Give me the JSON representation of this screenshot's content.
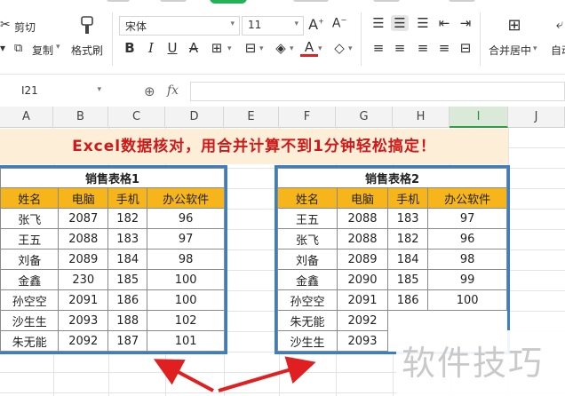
{
  "ribbon": {
    "cut_label": "剪切",
    "copy_label": "复制",
    "format_painter_label": "格式刷",
    "font_name": "宋体",
    "font_size": "11",
    "merge_center_label": "合并居中",
    "wrap_label": "自动",
    "accent_color": "#22b357"
  },
  "formula_bar": {
    "cell_ref": "I21",
    "fx_label": "fx",
    "content": ""
  },
  "columns": [
    "A",
    "B",
    "C",
    "D",
    "E",
    "F",
    "G",
    "H",
    "I",
    "J"
  ],
  "selected_column": "I",
  "banner": {
    "text": "Excel数据核对，用合并计算不到1分钟轻松搞定！",
    "color": "#d01818",
    "background": "#fdeed8"
  },
  "table1": {
    "title": "销售表格1",
    "headers": [
      "姓名",
      "电脑",
      "手机",
      "办公软件"
    ],
    "rows": [
      [
        "张飞",
        "2087",
        "182",
        "96"
      ],
      [
        "王五",
        "2088",
        "183",
        "97"
      ],
      [
        "刘备",
        "2089",
        "184",
        "98"
      ],
      [
        "金鑫",
        "230",
        "185",
        "100"
      ],
      [
        "孙空空",
        "2091",
        "186",
        "100"
      ],
      [
        "沙生生",
        "2093",
        "188",
        "102"
      ],
      [
        "朱无能",
        "2092",
        "187",
        "101"
      ]
    ]
  },
  "table2": {
    "title": "销售表格2",
    "headers": [
      "姓名",
      "电脑",
      "手机",
      "办公软件"
    ],
    "rows": [
      [
        "王五",
        "2088",
        "183",
        "97"
      ],
      [
        "张飞",
        "2088",
        "182",
        "96"
      ],
      [
        "刘备",
        "2089",
        "184",
        "98"
      ],
      [
        "金鑫",
        "2090",
        "185",
        "99"
      ],
      [
        "孙空空",
        "2091",
        "186",
        "100"
      ],
      [
        "朱无能",
        "2092",
        "",
        ""
      ],
      [
        "沙生生",
        "2093",
        "",
        ""
      ]
    ]
  },
  "watermark": "软件技巧",
  "colors": {
    "header_fill": "#f7b51c",
    "table_border": "#3a7fc1",
    "arrow": "#e02020"
  }
}
